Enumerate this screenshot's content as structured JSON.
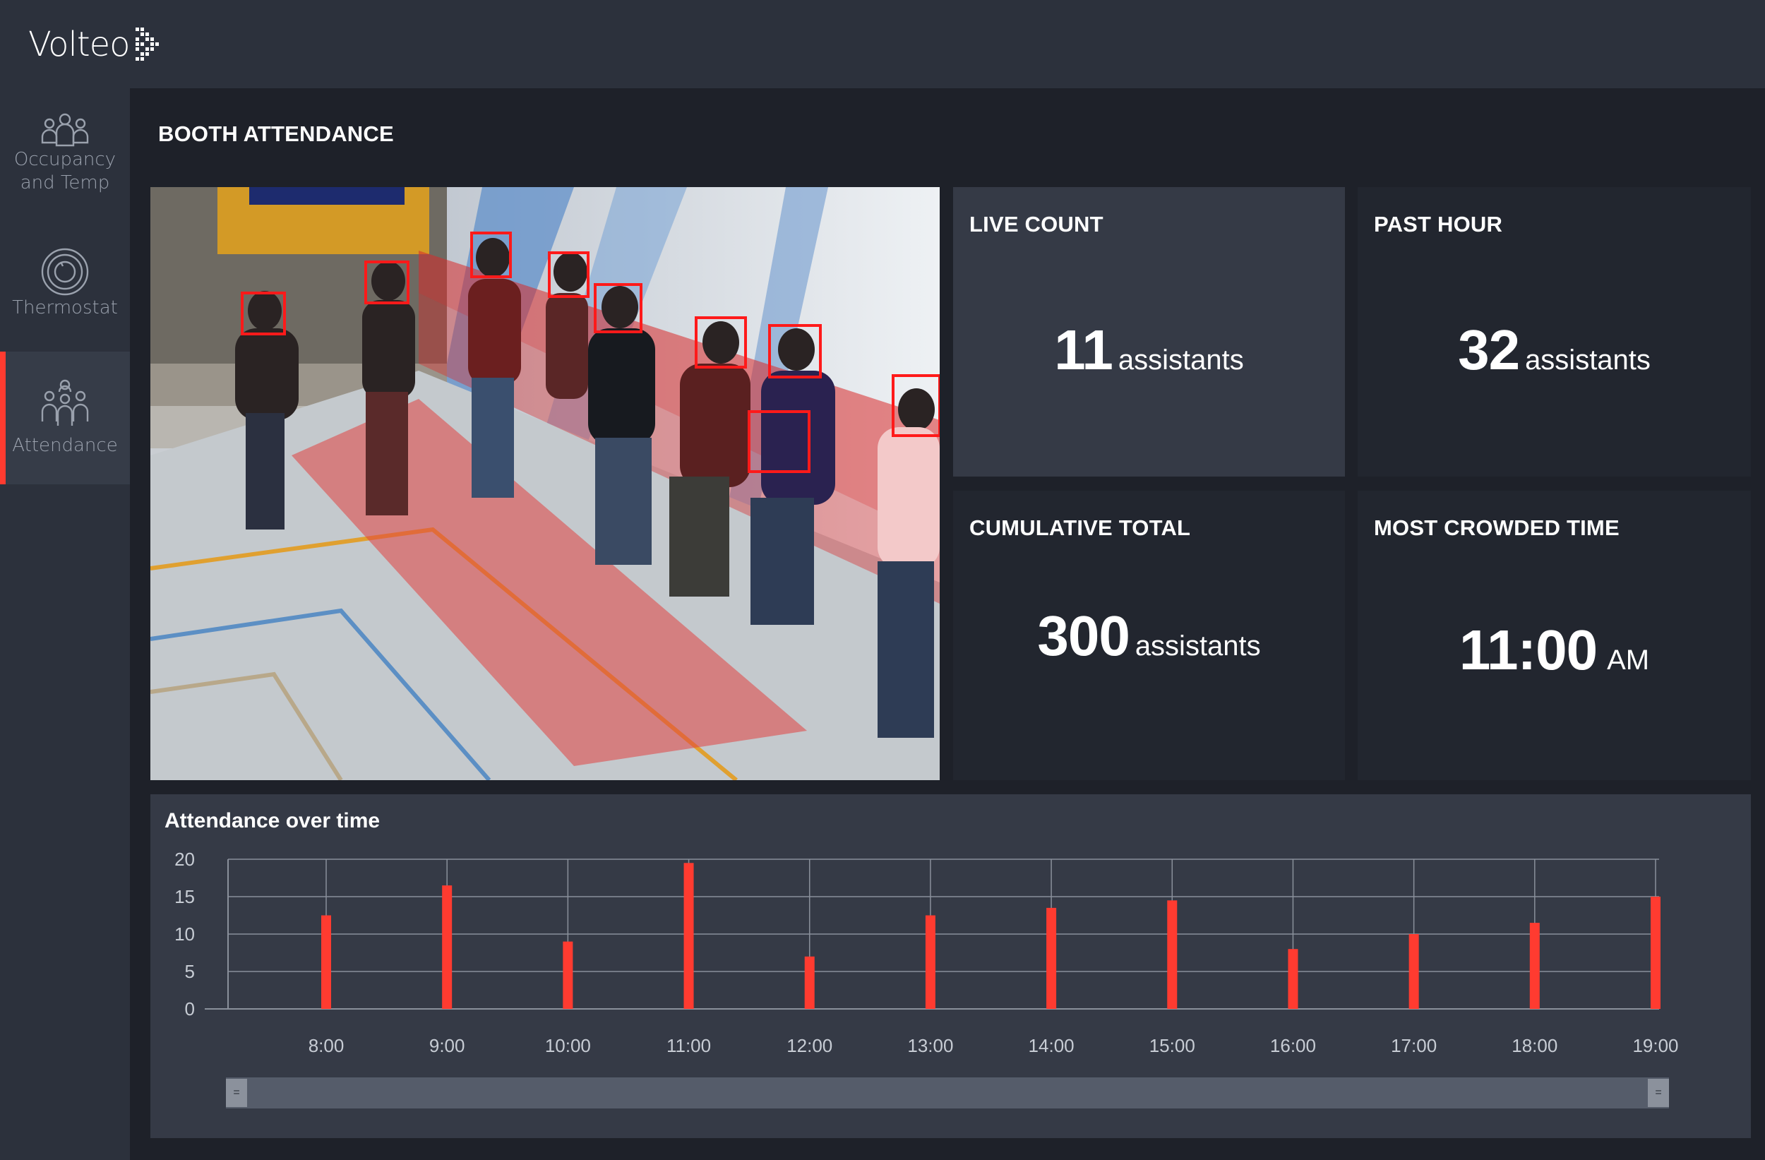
{
  "app": {
    "brand": "Volteo",
    "accent_color": "#ff3b30"
  },
  "sidebar": {
    "items": [
      {
        "label": "Occupancy\nand Temp",
        "icon": "people-group-icon",
        "active": false
      },
      {
        "label": "Thermostat",
        "icon": "thermostat-dial-icon",
        "active": false
      },
      {
        "label": "Attendance",
        "icon": "attendance-people-icon",
        "active": true
      }
    ]
  },
  "page": {
    "title": "BOOTH ATTENDANCE"
  },
  "camera": {
    "description_icon": "camera-feed-image",
    "detections": 11
  },
  "stats": {
    "live_count": {
      "title": "LIVE COUNT",
      "value": "11",
      "unit": "assistants"
    },
    "past_hour": {
      "title": "PAST HOUR",
      "value": "32",
      "unit": "assistants"
    },
    "cumulative_total": {
      "title": "CUMULATIVE TOTAL",
      "value": "300",
      "unit": "assistants"
    },
    "most_crowded_time": {
      "title": "MOST CROWDED TIME",
      "value": "11:00",
      "unit": "AM"
    }
  },
  "chart": {
    "title": "Attendance over time",
    "slider_handle_left": "=",
    "slider_handle_right": "="
  },
  "chart_data": {
    "type": "bar",
    "title": "Attendance over time",
    "categories": [
      "8:00",
      "9:00",
      "10:00",
      "11:00",
      "12:00",
      "13:00",
      "14:00",
      "15:00",
      "16:00",
      "17:00",
      "18:00",
      "19:00"
    ],
    "values": [
      12.5,
      16.5,
      9,
      19.5,
      7,
      12.5,
      13.5,
      14.5,
      8,
      10,
      11.5,
      15
    ],
    "yticks": [
      0,
      5,
      10,
      15,
      20
    ],
    "ylim": [
      0,
      20
    ],
    "bar_color": "#ff3b30",
    "grid": true
  }
}
